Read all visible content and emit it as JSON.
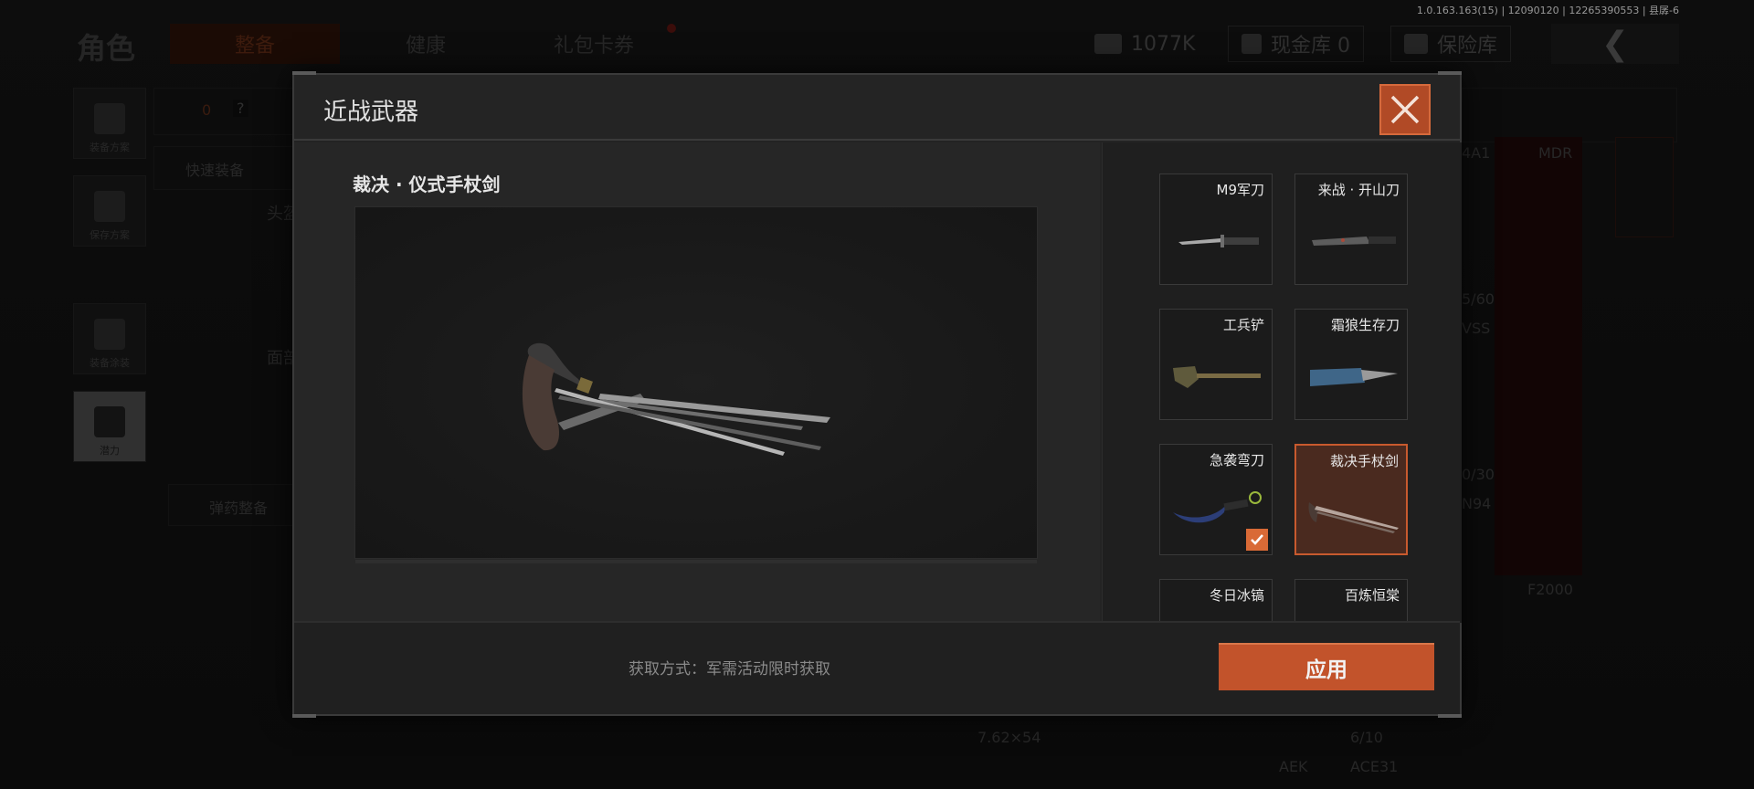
{
  "version_info": "1.0.163.163(15) | 12090120 | 12265390553 | 县孱-6",
  "background": {
    "page_title": "角色",
    "tabs": [
      {
        "label": "整备",
        "active": true
      },
      {
        "label": "健康",
        "active": false
      },
      {
        "label": "礼包卡券",
        "active": false
      }
    ],
    "currency": {
      "amount": "1077K",
      "cash_storage": "现金库 0",
      "safe_box": "保险库"
    },
    "sidebar": [
      {
        "label": "装备方案",
        "icon": "armor-icon"
      },
      {
        "label": "保存方案",
        "icon": "download-icon"
      },
      {
        "label": "装备涂装",
        "icon": "skull-icon"
      },
      {
        "label": "潜力",
        "icon": "hexagon-bolt-icon"
      }
    ],
    "armor_count": "0",
    "armor_unknown": "?",
    "quick_equip": "快速装备",
    "head_label": "头盔",
    "face_label": "面部",
    "ammo_equip": "弹药整备",
    "gun_labels": [
      "4A1",
      "MDR",
      "5/60",
      "VSS",
      "0/30",
      "N94",
      "F2000"
    ],
    "ammo_caliber": "7.62×54",
    "ammo_count": "6/10",
    "bottom_guns": [
      "AEK",
      "ACE31"
    ]
  },
  "modal": {
    "title": "近战武器",
    "selected_item_name": "裁决 · 仪式手杖剑",
    "obtain_method": "获取方式：军需活动限时获取",
    "apply_label": "应用",
    "weapons": [
      {
        "name": "M9军刀",
        "icon": "combat-knife-icon",
        "selected": false,
        "equipped": false
      },
      {
        "name": "来战 · 开山刀",
        "icon": "machete-icon",
        "selected": false,
        "equipped": false
      },
      {
        "name": "工兵铲",
        "icon": "shovel-icon",
        "selected": false,
        "equipped": false
      },
      {
        "name": "霜狼生存刀",
        "icon": "survival-knife-icon",
        "selected": false,
        "equipped": false
      },
      {
        "name": "急袭弯刀",
        "icon": "karambit-icon",
        "selected": false,
        "equipped": true
      },
      {
        "name": "裁决手杖剑",
        "icon": "cane-sword-icon",
        "selected": true,
        "equipped": false
      },
      {
        "name": "冬日冰镐",
        "icon": "ice-axe-icon",
        "selected": false,
        "equipped": false
      },
      {
        "name": "百炼恒棠",
        "icon": "blade-icon",
        "selected": false,
        "equipped": false
      }
    ]
  },
  "colors": {
    "accent": "#c2532b",
    "selected_border": "#c85a2e",
    "check": "#d96a36"
  }
}
